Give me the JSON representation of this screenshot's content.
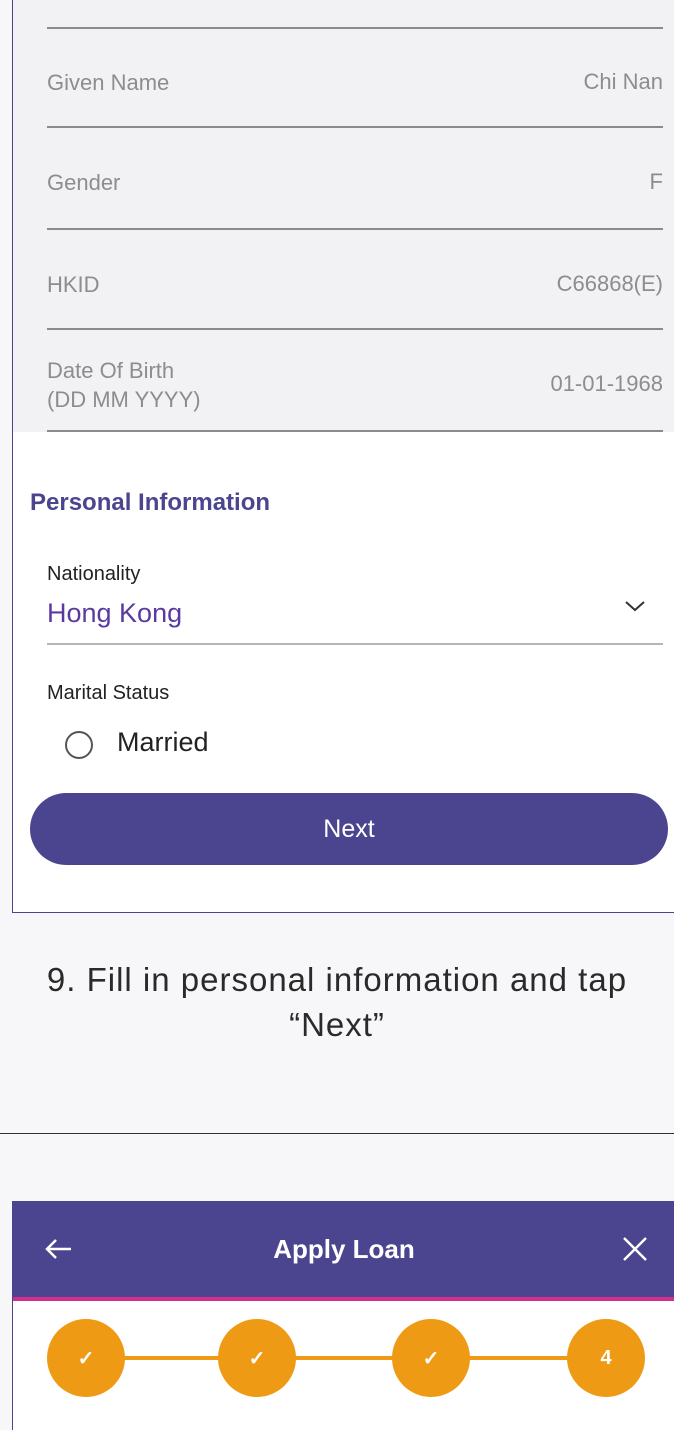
{
  "identity": {
    "fields": [
      {
        "label": "Given Name",
        "value": "Chi Nan"
      },
      {
        "label": "Gender",
        "value": "F"
      },
      {
        "label": "HKID",
        "value": "C66868(E)"
      },
      {
        "label": "Date Of Birth\n(DD MM YYYY)",
        "value": "01-01-1968"
      }
    ]
  },
  "personal_info": {
    "section_title": "Personal Information",
    "nationality": {
      "label": "Nationality",
      "value": "Hong Kong"
    },
    "marital_status": {
      "label": "Marital Status",
      "option": "Married",
      "selected": false
    }
  },
  "next_button": {
    "label": "Next"
  },
  "caption": "9. Fill in personal information and tap “Next”",
  "apply_loan": {
    "title": "Apply Loan",
    "steps": [
      {
        "label": "✓",
        "done": true
      },
      {
        "label": "✓",
        "done": true
      },
      {
        "label": "✓",
        "done": true
      },
      {
        "label": "4",
        "done": false
      }
    ]
  },
  "colors": {
    "primary": "#4b4590",
    "accent": "#d22f8c",
    "step": "#ef9a14"
  }
}
